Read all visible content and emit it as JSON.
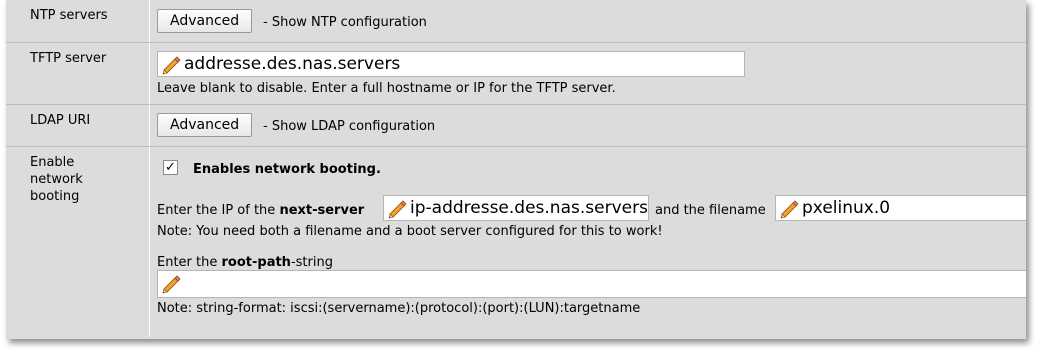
{
  "ntp": {
    "label": "NTP servers",
    "button": "Advanced",
    "description": "- Show NTP configuration"
  },
  "tftp": {
    "label": "TFTP server",
    "value": "addresse.des.nas.servers",
    "help": "Leave blank to disable. Enter a full hostname or IP for the TFTP server."
  },
  "ldap": {
    "label": "LDAP URI",
    "button": "Advanced",
    "description": "- Show LDAP configuration"
  },
  "netboot": {
    "label": "Enable network booting",
    "checkbox_checked": true,
    "checkbox_mark": "✓",
    "checkbox_label": "Enables network booting.",
    "ip_prefix": "Enter the IP of the ",
    "ip_bold": "next-server",
    "next_server_value": "ip-addresse.des.nas.servers",
    "filename_prefix": "and the filename",
    "filename_value": "pxelinux.0",
    "note1": "Note: You need both a filename and a boot server configured for this to work!",
    "root_prefix": "Enter the ",
    "root_bold": "root-path",
    "root_suffix": "-string",
    "root_path_value": "",
    "note2": "Note: string-format: iscsi:(servername):(protocol):(port):(LUN):targetname"
  }
}
